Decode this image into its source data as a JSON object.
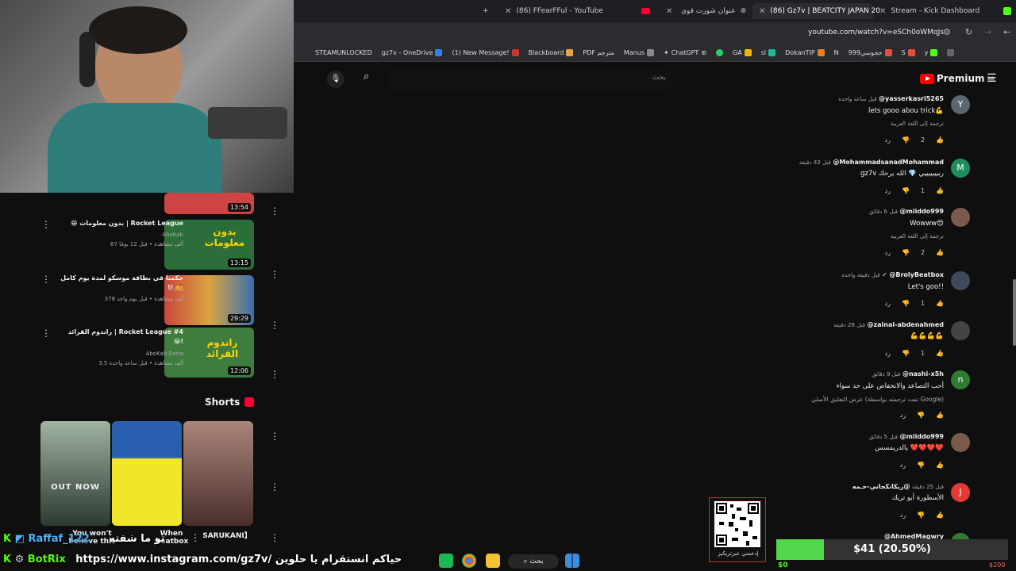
{
  "browser": {
    "tabs": [
      {
        "label": "(86) FFearFFul - YouTube",
        "active": false,
        "icon": "youtube-icon"
      },
      {
        "label": "عنوان شورت قوي",
        "active": false,
        "icon": "chatgpt-icon"
      },
      {
        "label": "(86) Gz7v | BEATCITY JAPAN 20",
        "active": true,
        "icon": "youtube-icon"
      },
      {
        "label": "Stream - Kick Dashboard",
        "active": false,
        "icon": "kick-icon"
      }
    ],
    "new_tab": "+",
    "url": "youtube.com/watch?v=eSCh0oWMqJs",
    "bookmarks": [
      "STEAMUNLOCKED",
      "gz7v - OneDrive",
      "(1) New Message!",
      "Blackboard",
      "PDF مترجم",
      "Manus",
      "ChatGPT",
      "GA",
      "sl",
      "DokanTIP",
      "N",
      "حجوسي999",
      "S",
      "y"
    ]
  },
  "youtube": {
    "search_placeholder": "بحث",
    "logo_text": "Premium",
    "region": "SA"
  },
  "sidebar_videos": [
    {
      "title": "",
      "channel": "",
      "meta": "",
      "duration": "13:54",
      "thumb_color": "#c44"
    },
    {
      "title": "😁 بدون معلومات | Rocket League",
      "channel": "AboKab",
      "meta": "87 ألف مشاهدة • قبل 12 يومًا",
      "duration": "13:15",
      "thumb_text": "بدون معلومات"
    },
    {
      "title": "حكمنا في بطاقة موسكو لمدة يوم كامل !! 🍊",
      "channel": "F R S",
      "meta": "378 ألف مشاهدة • قبل يوم واحد",
      "duration": "29:29"
    },
    {
      "title": "راندوم القرائد | Rocket League #4 😁!",
      "channel": "AboKab Extra",
      "meta": "3.5 ألف مشاهدة • قبل ساعة واحدة",
      "duration": "12:06",
      "thumb_text": "راندوم القرائد"
    }
  ],
  "shorts": {
    "title": "Shorts",
    "items": [
      {
        "label": "You won't believe this",
        "overlay": "OUT NOW"
      },
      {
        "label": "When beatbox"
      },
      {
        "label": "SARUKANI】"
      }
    ]
  },
  "comments": [
    {
      "user": "@yasserkasri5265",
      "time": "قبل ساعة واحدة",
      "text": "lets gooo abou trick💪",
      "translate": "ترجمة إلى اللغة العربية",
      "likes": "2",
      "reply": "رد",
      "avatar": "Y",
      "avatar_color": "#5a6670"
    },
    {
      "user": "@MohammadsanadMohammad",
      "time": "قبل 43 دقيقة",
      "text": "gz7v ربيييييييي 💎 الله يرحك",
      "likes": "1",
      "reply": "رد",
      "avatar": "M",
      "avatar_color": "#1e8e5e"
    },
    {
      "user": "@miiddo999",
      "time": "قبل 6 دقائق",
      "text": "Wowww😍",
      "translate": "ترجمة إلى اللغة العربية",
      "likes": "2",
      "reply": "رد",
      "avatar": "",
      "avatar_color": "#7a5a4a"
    },
    {
      "user": "@BrolyBeatbox",
      "time": "قبل دقيقة واحدة",
      "text": "Let's goo!!",
      "likes": "1",
      "reply": "رد",
      "avatar": "",
      "avatar_color": "#3c4a5a"
    },
    {
      "user": "@zainal-abdenahmed",
      "time": "قبل 28 دقيقة",
      "text": "💪💪💪💪",
      "likes": "1",
      "reply": "رد",
      "avatar": "",
      "avatar_color": "#444"
    },
    {
      "user": "@nashi-x5h",
      "time": "قبل 9 دقائق",
      "text": "أحب التصاعد والانخفاض على حد سواء",
      "translate": "عرض التعليق الأصلي (تمت ترجمته بواسطة Google)",
      "likes": "",
      "reply": "رد",
      "avatar": "n",
      "avatar_color": "#2e7d32"
    },
    {
      "user": "@miiddo999",
      "time": "قبل 5 دقائق",
      "text": "يالدريمسس ❤️❤️❤️❤️",
      "likes": "",
      "reply": "رد",
      "avatar": "",
      "avatar_color": "#7a5a4a"
    },
    {
      "user": "@ريكانكجاني-حـمه",
      "time": "قبل 25 دقيقة",
      "text": "الأسطورة أبو تريك",
      "likes": "",
      "reply": "رد",
      "avatar": "J",
      "avatar_color": "#e53935"
    },
    {
      "user": "@AhmedMagwry",
      "time": "",
      "text": "",
      "likes": "",
      "reply": "",
      "avatar": "",
      "avatar_color": "#2e7d32"
    }
  ],
  "stream_overlay": {
    "qr_label": "إدعمني عبرتريكيز",
    "donation": {
      "label": "$41 (20.50%)",
      "progress": 0.205,
      "min": "$0",
      "max": "$200"
    },
    "chat": [
      {
        "user": "Raffaf_122",
        "message": "تو ما شفته"
      },
      {
        "user": "BotRix",
        "message": "https://www.instagram.com/gz7v/ حياكم انستقرام يا حلوين"
      }
    ]
  },
  "taskbar": {
    "search": "بحث"
  }
}
